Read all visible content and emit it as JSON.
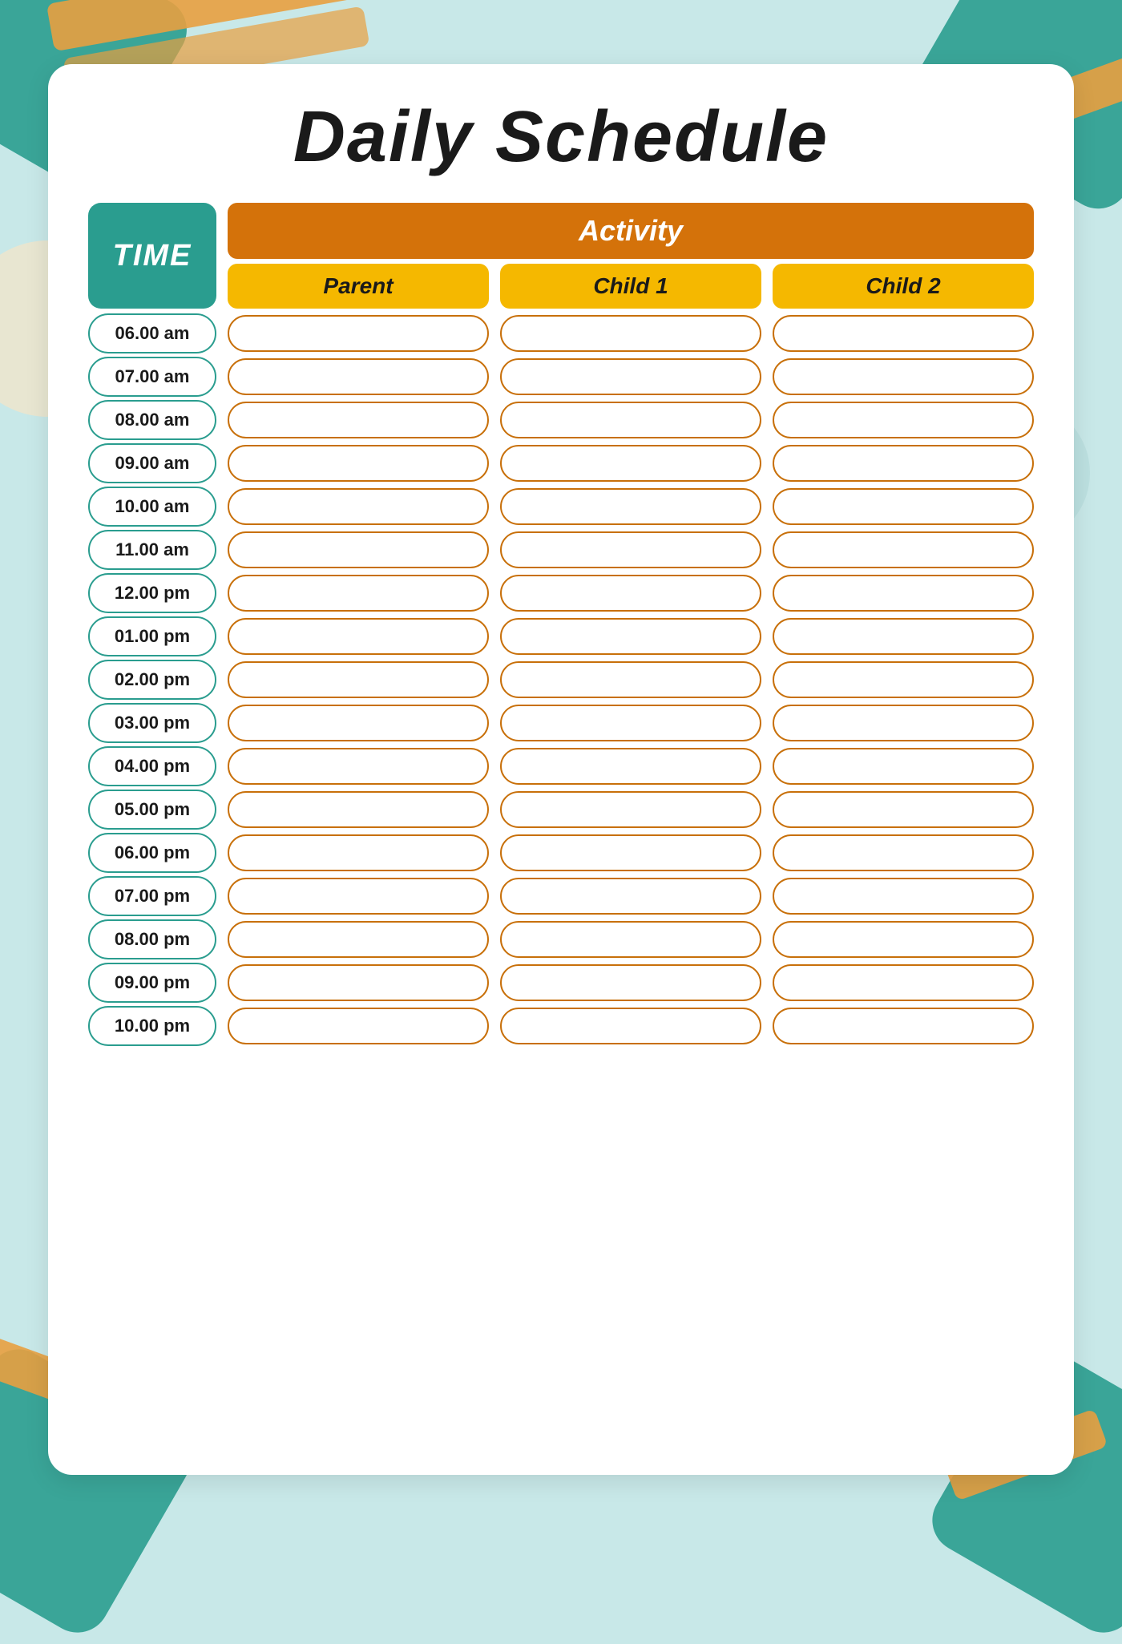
{
  "title": "Daily Schedule",
  "header": {
    "time_label": "TIME",
    "activity_label": "Activity",
    "col1_label": "Parent",
    "col2_label": "Child 1",
    "col3_label": "Child 2"
  },
  "time_slots": [
    "06.00 am",
    "07.00 am",
    "08.00 am",
    "09.00 am",
    "10.00 am",
    "11.00 am",
    "12.00 pm",
    "01.00 pm",
    "02.00 pm",
    "03.00 pm",
    "04.00 pm",
    "05.00 pm",
    "06.00 pm",
    "07.00 pm",
    "08.00 pm",
    "09.00 pm",
    "10.00 pm"
  ]
}
